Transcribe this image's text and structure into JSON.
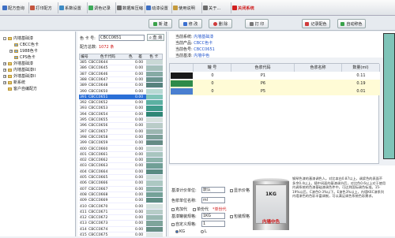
{
  "toolbar": {
    "items": [
      {
        "label": "配方查询",
        "icon": "search-icon",
        "color": "#3d6fc4"
      },
      {
        "label": "打印配方",
        "icon": "print-icon",
        "color": "#c4543d"
      },
      {
        "label": "系数设置",
        "icon": "settings-icon",
        "color": "#3d8bc4"
      },
      {
        "label": "调色记录",
        "icon": "record-icon",
        "color": "#3daa5a"
      },
      {
        "label": "数据库压缩",
        "icon": "database-icon",
        "color": "#6b6b6b"
      },
      {
        "label": "动漆设置",
        "icon": "paint-icon",
        "color": "#3d6fc4"
      },
      {
        "label": "使用说明",
        "icon": "help-icon",
        "color": "#c49a3d"
      },
      {
        "label": "关于...",
        "icon": "info-icon",
        "color": "#6b6b6b"
      },
      {
        "label": "关闭系统",
        "icon": "power-icon",
        "color": "#d02020"
      }
    ]
  },
  "actions": {
    "new": "新 建",
    "modify": "修 改",
    "delete": "删 除",
    "print": "打 印",
    "record": "记录配色",
    "auto": "自动称色"
  },
  "tree": [
    {
      "label": "内墙基础漆",
      "level": 0,
      "sign": "-"
    },
    {
      "label": "CBCC色卡",
      "level": 1,
      "sign": ""
    },
    {
      "label": "1988色卡",
      "level": 1,
      "sign": "+"
    },
    {
      "label": "CPS色卡",
      "level": 1,
      "sign": ""
    },
    {
      "label": "外墙基础漆",
      "level": 0,
      "sign": "+"
    },
    {
      "label": "内墙基础漆II",
      "level": 0,
      "sign": "+"
    },
    {
      "label": "外墙基础漆II",
      "level": 0,
      "sign": "+"
    },
    {
      "label": "新系统",
      "level": 0,
      "sign": "+"
    },
    {
      "label": "客户自编配方",
      "level": 0,
      "sign": ""
    }
  ],
  "search": {
    "card_label": "色 卡 号:",
    "card_value": "CBCC0651",
    "button": "查 询",
    "count_label": "配方总数:",
    "count_value": "1072 条"
  },
  "grid": {
    "headers": [
      "编号",
      "色卡代码",
      "色",
      "差",
      "色 卡"
    ],
    "selected_index": 6,
    "rows": [
      {
        "no": "385",
        "code": "CBCC0644",
        "v": "0.00",
        "sw": "#c9d8d5"
      },
      {
        "no": "386",
        "code": "CBCC0645",
        "v": "0.00",
        "sw": "#a6c0bb"
      },
      {
        "no": "387",
        "code": "CBCC0646",
        "v": "0.00",
        "sw": "#86aaa4"
      },
      {
        "no": "388",
        "code": "CBCC0647",
        "v": "0.00",
        "sw": "#6b958f"
      },
      {
        "no": "389",
        "code": "CBCC0648",
        "v": "0.00",
        "sw": "#56827d"
      },
      {
        "no": "390",
        "code": "CBCC0650",
        "v": "0.00",
        "sw": "#b7d9d3"
      },
      {
        "no": "391",
        "code": "CBCC0651",
        "v": "0.00",
        "sw": "#7fc4b8"
      },
      {
        "no": "392",
        "code": "CBCC0652",
        "v": "0.00",
        "sw": "#5bb0a1"
      },
      {
        "no": "393",
        "code": "CBCC0653",
        "v": "0.00",
        "sw": "#3f9b8b"
      },
      {
        "no": "394",
        "code": "CBCC0654",
        "v": "0.00",
        "sw": "#2f8676"
      },
      {
        "no": "395",
        "code": "CBCC0655",
        "v": "0.00",
        "sw": "#d5e0dd"
      },
      {
        "no": "396",
        "code": "CBCC0656",
        "v": "0.00",
        "sw": "#b9ccc8"
      },
      {
        "no": "397",
        "code": "CBCC0657",
        "v": "0.00",
        "sw": "#9bb6b0"
      },
      {
        "no": "398",
        "code": "CBCC0658",
        "v": "0.00",
        "sw": "#7da099"
      },
      {
        "no": "399",
        "code": "CBCC0659",
        "v": "0.00",
        "sw": "#648b84"
      },
      {
        "no": "400",
        "code": "CBCC0660",
        "v": "0.00",
        "sw": "#c5d7d3"
      },
      {
        "no": "401",
        "code": "CBCC0661",
        "v": "0.00",
        "sw": "#a8c5bf"
      },
      {
        "no": "402",
        "code": "CBCC0662",
        "v": "0.00",
        "sw": "#8cb3ab"
      },
      {
        "no": "403",
        "code": "CBCC0663",
        "v": "0.00",
        "sw": "#709f96"
      },
      {
        "no": "404",
        "code": "CBCC0664",
        "v": "0.00",
        "sw": "#598b82"
      },
      {
        "no": "405",
        "code": "CBCC0665",
        "v": "0.00",
        "sw": "#cbdcd8"
      },
      {
        "no": "406",
        "code": "CBCC0666",
        "v": "0.00",
        "sw": "#acc8c2"
      },
      {
        "no": "407",
        "code": "CBCC0667",
        "v": "0.00",
        "sw": "#8fb4ad"
      },
      {
        "no": "408",
        "code": "CBCC0668",
        "v": "0.00",
        "sw": "#74a198"
      },
      {
        "no": "409",
        "code": "CBCC0669",
        "v": "0.00",
        "sw": "#5d8d84"
      },
      {
        "no": "410",
        "code": "CBCC0670",
        "v": "0.00",
        "sw": "#d4e1de"
      },
      {
        "no": "411",
        "code": "CBCC0671",
        "v": "0.00",
        "sw": "#b6ccc7"
      },
      {
        "no": "412",
        "code": "CBCC0672",
        "v": "0.00",
        "sw": "#99b8b1"
      },
      {
        "no": "413",
        "code": "CBCC0673",
        "v": "0.00",
        "sw": "#7ea49b"
      },
      {
        "no": "414",
        "code": "CBCC0674",
        "v": "0.00",
        "sw": "#668f86"
      },
      {
        "no": "415",
        "code": "CBCC0675",
        "v": "0.00",
        "sw": "#dfe8e6"
      }
    ]
  },
  "info": {
    "system_label": "当前系统:",
    "system_value": "内墙基础漆",
    "product_label": "当前产品:",
    "product_value": "CBCC色卡",
    "color_label": "当前色号:",
    "color_value": "CBCC0651",
    "base_label": "当前基漆:",
    "base_value": "内墙中色"
  },
  "formula": {
    "headers": [
      "罐 号",
      "色浆代码",
      "色浆名称",
      "数量(ml)"
    ],
    "rows": [
      {
        "swatch": "#1a1a1a",
        "no": "0",
        "code": "P1",
        "name": "",
        "qty": "0.11"
      },
      {
        "swatch": "#2e8b4a",
        "no": "0",
        "code": "P6",
        "name": "",
        "qty": "0.19"
      },
      {
        "swatch": "#4a7fd0",
        "no": "0",
        "code": "P5",
        "name": "",
        "qty": "0.01"
      }
    ]
  },
  "options": {
    "base_unit_label": "基漆计价单位:",
    "base_unit_value": "默认",
    "show_price": "显示价格",
    "colorant_unit_label": "色浆单位名称:",
    "colorant_unit_value": "ml",
    "opt_a": "克加代",
    "opt_b": "单份代",
    "note_red": "*单份代",
    "spec_label": "基漆罐装规格:",
    "spec_value": "1KG",
    "spec_btn": "包装规格",
    "custom_label": "自定义规格:",
    "custom_value": "1",
    "unit_kg": "KG",
    "unit_l": "L"
  },
  "can": {
    "size": "1KG",
    "label": "内墙中色"
  },
  "description": "钢琴色漆的基漆调色人。对比本白0.87以上，调浆色的表面不多余0.4以上，随中间面的基漆调节后，对比色0.6以上对于使用内调系统的色漆基础漆调色件中，可达到国际调色标准。15-19%以后，C漆色0-3%以下。E漆色3%以上，内墙K6C漆系列内墙漆色的色彩丰富调制，可以满足调色系统色彩需求。"
}
